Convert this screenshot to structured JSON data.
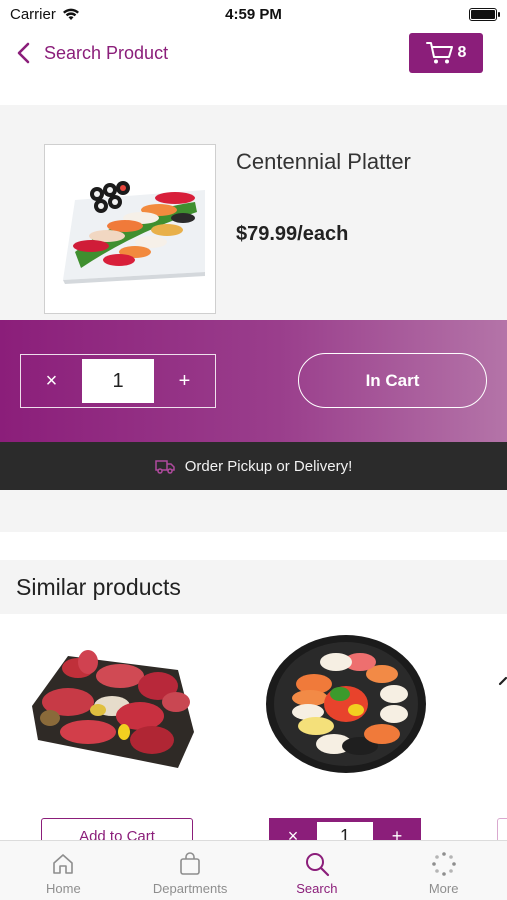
{
  "status_bar": {
    "carrier": "Carrier",
    "time": "4:59 PM"
  },
  "header": {
    "back_label": "Search Product",
    "cart_count": "8"
  },
  "product": {
    "name": "Centennial Platter",
    "price": "$79.99/each",
    "quantity": "1",
    "in_cart_label": "In Cart",
    "remove_symbol": "×",
    "add_symbol": "+"
  },
  "banner": {
    "text": "Order Pickup or Delivery!",
    "icon": "truck-icon"
  },
  "similar": {
    "title": "Similar products",
    "items": [
      {
        "image": "wagyu-platter",
        "action_label": "Add to Cart"
      },
      {
        "image": "sushi-tray",
        "quantity": "1",
        "remove_symbol": "×",
        "add_symbol": "+"
      }
    ]
  },
  "tabs": [
    {
      "label": "Home",
      "icon": "home-icon",
      "active": false
    },
    {
      "label": "Departments",
      "icon": "bag-icon",
      "active": false
    },
    {
      "label": "Search",
      "icon": "search-icon",
      "active": true
    },
    {
      "label": "More",
      "icon": "more-icon",
      "active": false
    }
  ],
  "colors": {
    "brand": "#8b1e7a",
    "dark_bar": "#2b2b2b",
    "panel": "#f4f4f4"
  }
}
